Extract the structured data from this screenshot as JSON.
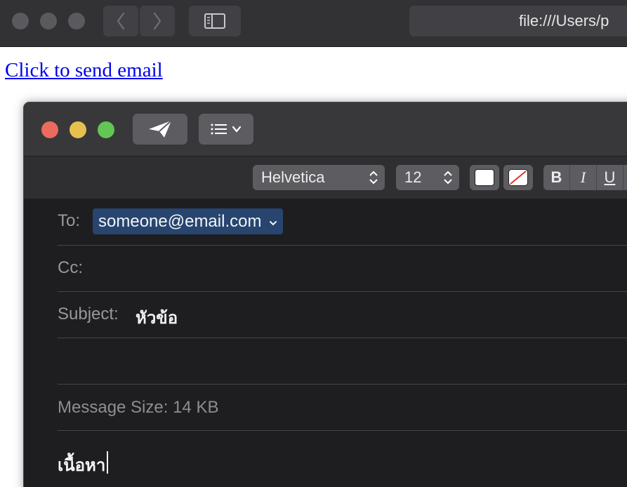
{
  "browser": {
    "url": "file:///Users/p",
    "back_icon": "chevron-left-icon",
    "forward_icon": "chevron-right-icon",
    "sidebar_icon": "sidebar-icon"
  },
  "page": {
    "link_text": "Click to send email"
  },
  "mail": {
    "toolbar": {
      "send_icon": "paper-plane-icon",
      "header_fields_icon": "list-icon"
    },
    "format": {
      "font": "Helvetica",
      "size": "12",
      "bold_label": "B",
      "italic_label": "I",
      "underline_label": "U"
    },
    "to_label": "To:",
    "to_value": "someone@email.com",
    "cc_label": "Cc:",
    "subject_label": "Subject:",
    "subject_value": "หัวข้อ",
    "message_size": "Message Size: 14 KB",
    "body": "เนื้อหา"
  },
  "colors": {
    "close": "#ed6a5e",
    "minimize": "#e7c04f",
    "zoom": "#62c554",
    "recipient_bg": "#27456e",
    "link": "#0000ee"
  }
}
